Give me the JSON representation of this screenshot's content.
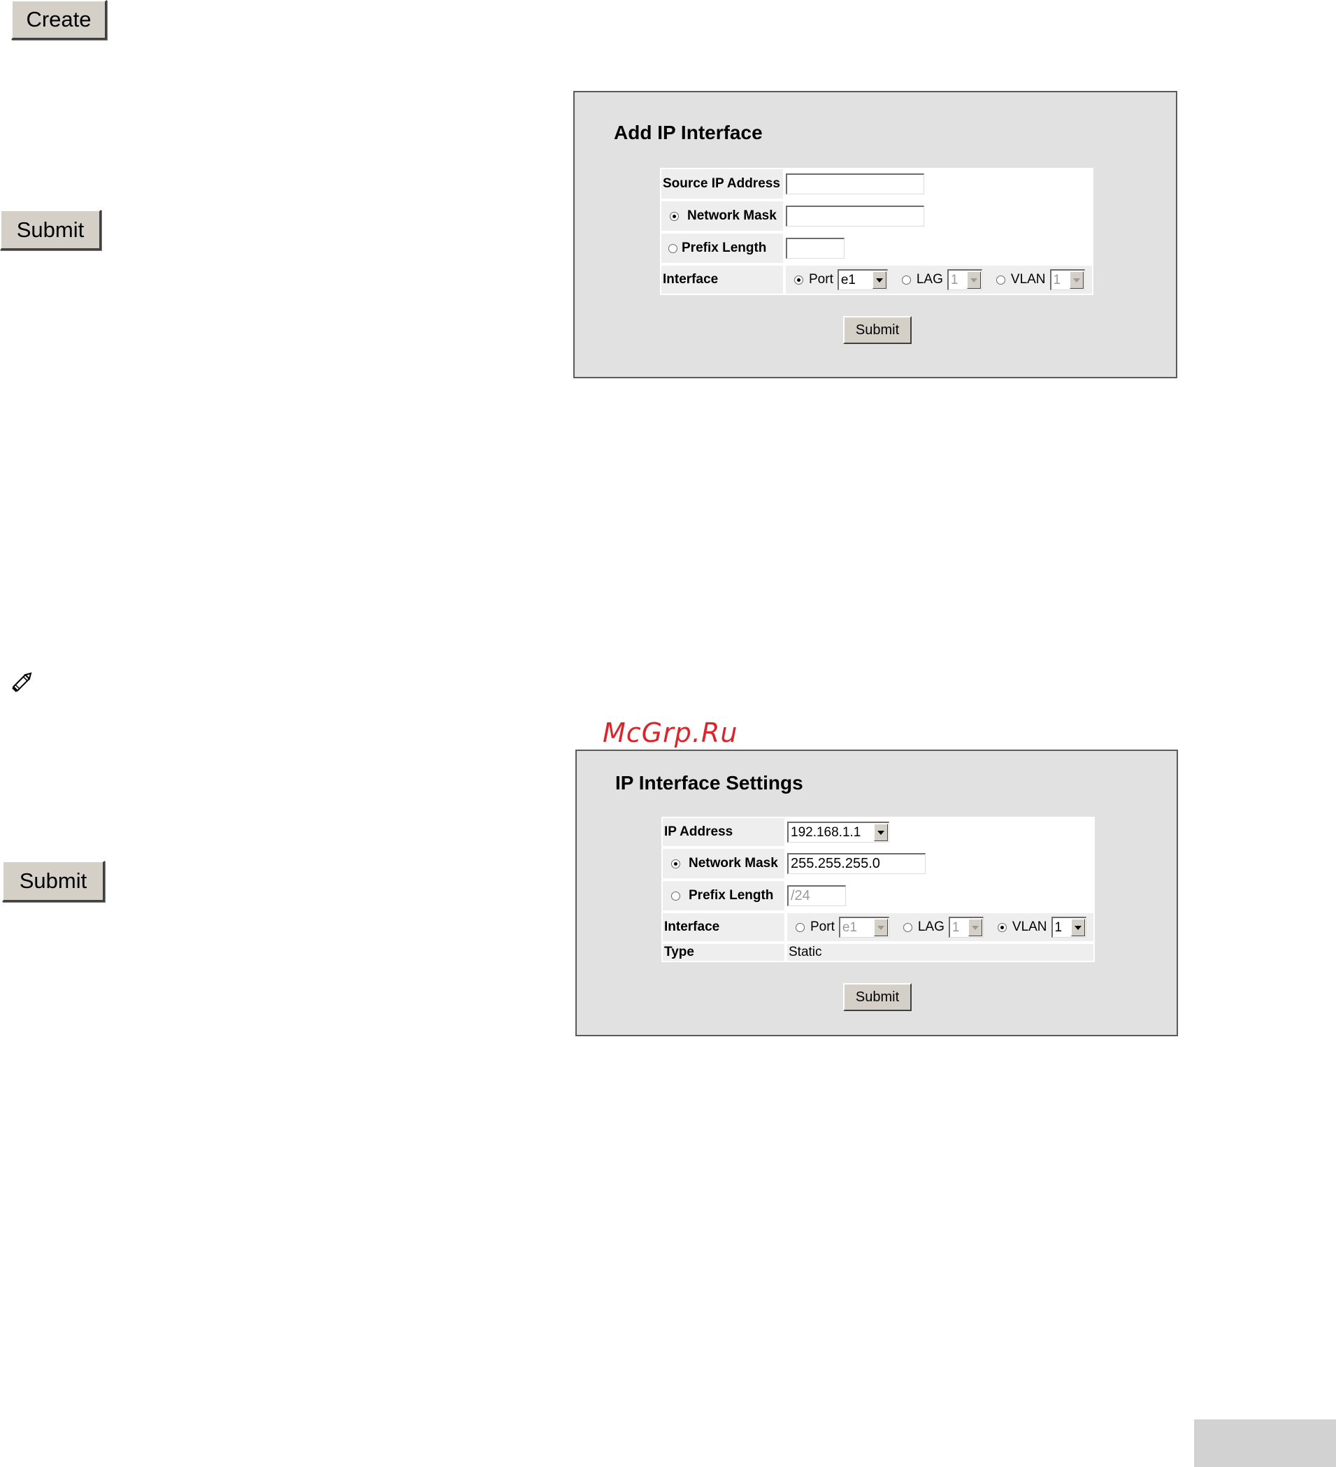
{
  "buttons": {
    "create": "Create",
    "submit_1": "Submit",
    "submit_2": "Submit"
  },
  "icons": {
    "note": "pencil-icon"
  },
  "watermark": "McGrp.Ru",
  "add_panel": {
    "title": "Add IP Interface",
    "source_ip_label": "Source IP Address",
    "source_ip_value": "",
    "network_mask_label": "Network Mask",
    "network_mask_value": "",
    "network_mask_selected": true,
    "prefix_length_label": "Prefix Length",
    "prefix_length_value": "",
    "interface_label": "Interface",
    "port_label": "Port",
    "port_value": "e1",
    "lag_label": "LAG",
    "lag_value": "1",
    "vlan_label": "VLAN",
    "vlan_value": "1",
    "interface_selected": "Port",
    "submit": "Submit"
  },
  "settings_panel": {
    "title": "IP Interface Settings",
    "ip_address_label": "IP Address",
    "ip_address_value": "192.168.1.1",
    "network_mask_label": "Network Mask",
    "network_mask_value": "255.255.255.0",
    "network_mask_selected": true,
    "prefix_length_label": "Prefix Length",
    "prefix_length_value": "/24",
    "interface_label": "Interface",
    "port_label": "Port",
    "port_value": "e1",
    "lag_label": "LAG",
    "lag_value": "1",
    "vlan_label": "VLAN",
    "vlan_value": "1",
    "interface_selected": "VLAN",
    "type_label": "Type",
    "type_value": "Static",
    "submit": "Submit"
  }
}
